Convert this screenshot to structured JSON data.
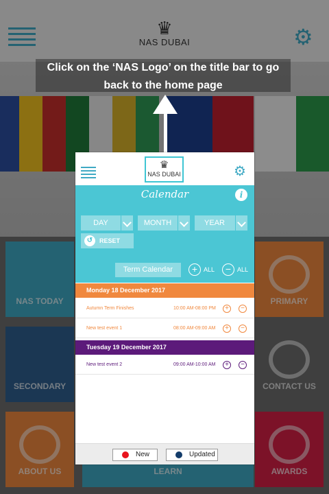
{
  "background": {
    "header": {
      "logo_text": "NAS DUBAI"
    },
    "tiles": [
      {
        "label": "NAS TODAY",
        "color": "#3ea9c4"
      },
      {
        "label": "PRIMARY",
        "color": "#f0883e"
      },
      {
        "label": "SECONDARY",
        "color": "#2f5f8f"
      },
      {
        "label": "CONTACT US",
        "color": "#6d6d6d"
      },
      {
        "label": "ABOUT US",
        "color": "#f0883e"
      },
      {
        "label": "LEARN",
        "color": "#3ea9c4"
      },
      {
        "label": "AWARDS",
        "color": "#d61f45"
      }
    ]
  },
  "hint": {
    "line1": "Click on the ‘NAS Logo’ on the title bar to go",
    "line2": "back to the home page"
  },
  "phone": {
    "header": {
      "logo_text": "NAS DUBAI"
    },
    "calendar": {
      "title": "Calendar",
      "info_icon": "i",
      "filters": {
        "day": "DAY",
        "month": "MONTH",
        "year": "YEAR"
      },
      "reset_label": "RESET",
      "term_calendar_label": "Term Calendar",
      "expand_all_label": "ALL",
      "collapse_all_label": "ALL"
    },
    "days": [
      {
        "heading": "Monday 18 December 2017",
        "color": "#f0883e",
        "events": [
          {
            "name": "Autumn Term Finishes",
            "time": "10:00 AM-08:00 PM"
          },
          {
            "name": "New test event 1",
            "time": "08:00 AM-09:00 AM"
          }
        ]
      },
      {
        "heading": "Tuesday 19 December 2017",
        "color": "#5c1a7a",
        "events": [
          {
            "name": "New test event 2",
            "time": "09:00 AM-10:00 AM"
          }
        ]
      }
    ],
    "legend": {
      "new_label": "New",
      "new_color": "#e8141e",
      "updated_label": "Updated",
      "updated_color": "#133c6a"
    }
  }
}
